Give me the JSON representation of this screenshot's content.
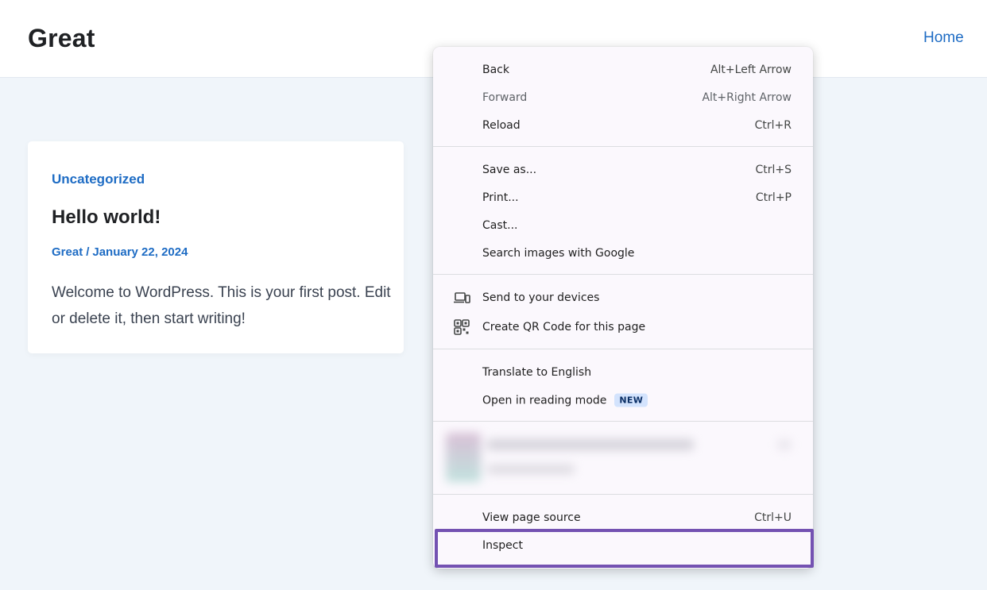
{
  "header": {
    "site_title": "Great",
    "nav_home": "Home"
  },
  "post": {
    "category": "Uncategorized",
    "title": "Hello world!",
    "author": "Great",
    "separator": "/",
    "date": "January 22, 2024",
    "excerpt": "Welcome to WordPress. This is your first post. Edit or delete it, then start writing!"
  },
  "context_menu": {
    "back": {
      "label": "Back",
      "shortcut": "Alt+Left Arrow"
    },
    "forward": {
      "label": "Forward",
      "shortcut": "Alt+Right Arrow"
    },
    "reload": {
      "label": "Reload",
      "shortcut": "Ctrl+R"
    },
    "save_as": {
      "label": "Save as...",
      "shortcut": "Ctrl+S"
    },
    "print": {
      "label": "Print...",
      "shortcut": "Ctrl+P"
    },
    "cast": {
      "label": "Cast..."
    },
    "search_images": {
      "label": "Search images with Google"
    },
    "send_devices": {
      "label": "Send to your devices",
      "icon": "devices-icon"
    },
    "qr_code": {
      "label": "Create QR Code for this page",
      "icon": "qr-code-icon"
    },
    "translate": {
      "label": "Translate to English"
    },
    "reading_mode": {
      "label": "Open in reading mode",
      "badge": "NEW"
    },
    "view_source": {
      "label": "View page source",
      "shortcut": "Ctrl+U"
    },
    "inspect": {
      "label": "Inspect"
    }
  },
  "colors": {
    "accent": "#1e6cc4",
    "highlight_border": "#7452b2",
    "page_background": "#f0f5fa",
    "menu_background": "#fbf8fd"
  }
}
